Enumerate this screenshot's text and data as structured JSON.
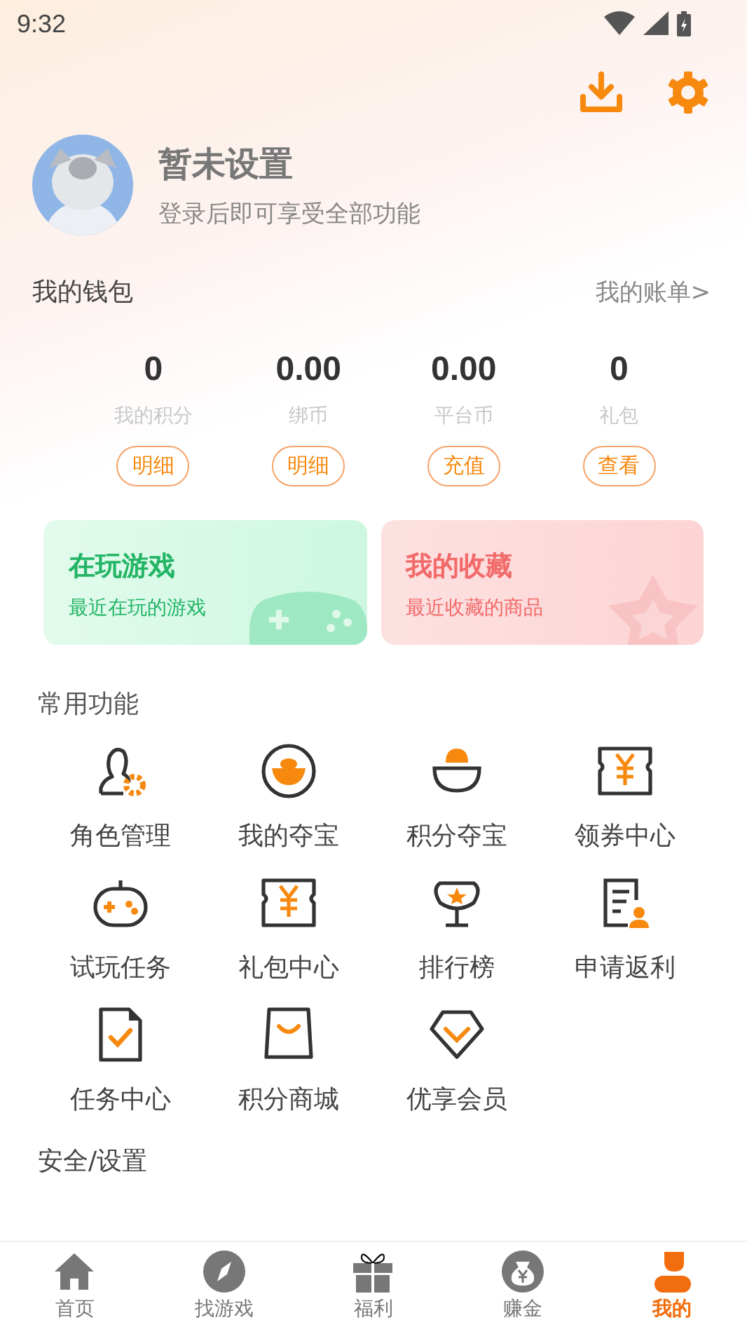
{
  "status_bar": {
    "time": "9:32"
  },
  "profile": {
    "name": "暂未设置",
    "subtitle": "登录后即可享受全部功能"
  },
  "wallet": {
    "title": "我的钱包",
    "link": "我的账单>",
    "stats": [
      {
        "value": "0",
        "label": "我的积分",
        "button": "明细"
      },
      {
        "value": "0.00",
        "label": "绑币",
        "button": "明细"
      },
      {
        "value": "0.00",
        "label": "平台币",
        "button": "充值"
      },
      {
        "value": "0",
        "label": "礼包",
        "button": "查看"
      }
    ]
  },
  "cards": [
    {
      "title": "在玩游戏",
      "subtitle": "最近在玩的游戏",
      "kind": "games"
    },
    {
      "title": "我的收藏",
      "subtitle": "最近收藏的商品",
      "kind": "favorites"
    }
  ],
  "functions": {
    "title": "常用功能",
    "items": [
      "角色管理",
      "我的夺宝",
      "积分夺宝",
      "领券中心",
      "试玩任务",
      "礼包中心",
      "排行榜",
      "申请返利",
      "任务中心",
      "积分商城",
      "优享会员"
    ]
  },
  "next_section": {
    "title": "安全/设置"
  },
  "tab_bar": [
    {
      "label": "首页",
      "selected": false
    },
    {
      "label": "找游戏",
      "selected": false
    },
    {
      "label": "福利",
      "selected": false
    },
    {
      "label": "赚金",
      "selected": false
    },
    {
      "label": "我的",
      "selected": true
    }
  ]
}
